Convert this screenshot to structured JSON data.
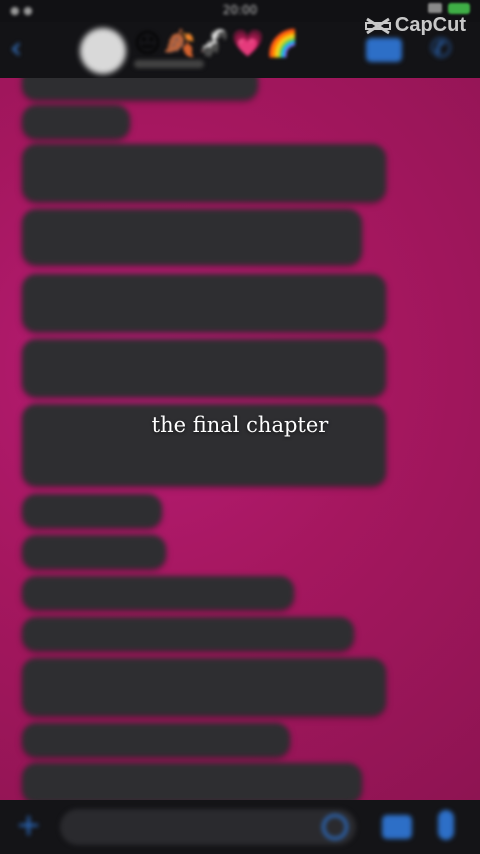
{
  "status_bar": {
    "time": "20:00"
  },
  "header": {
    "contact_name": "😐🍂🦨💗🌈",
    "watermark": "CapCut"
  },
  "messages": [
    {
      "text": "",
      "time": ""
    },
    {
      "text": "",
      "time": ""
    },
    {
      "text": "",
      "time": ""
    },
    {
      "text": "",
      "time": ""
    },
    {
      "text": "",
      "time": ""
    },
    {
      "text": "",
      "time": ""
    },
    {
      "text": "",
      "time": ""
    },
    {
      "text": "",
      "time": ""
    },
    {
      "text": "",
      "time": ""
    },
    {
      "text": "",
      "time": ""
    },
    {
      "text": "",
      "time": ""
    },
    {
      "text": "",
      "time": ""
    },
    {
      "text": "",
      "time": ""
    },
    {
      "text": "",
      "time": ""
    }
  ],
  "caption": "the final chapter",
  "colors": {
    "chat_background": "#a5175f",
    "bubble": "#2e2e31",
    "accent": "#2d6fc7"
  },
  "icons": [
    "back-icon",
    "avatar",
    "video-call-icon",
    "phone-icon",
    "plus-icon",
    "sticker-icon",
    "camera-icon",
    "microphone-icon"
  ]
}
